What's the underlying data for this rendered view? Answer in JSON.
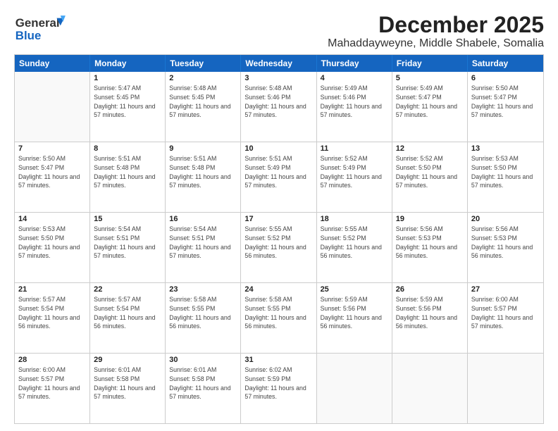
{
  "logo": {
    "line1": "General",
    "line2": "Blue"
  },
  "title": "December 2025",
  "subtitle": "Mahaddayweyne, Middle Shabele, Somalia",
  "header_days": [
    "Sunday",
    "Monday",
    "Tuesday",
    "Wednesday",
    "Thursday",
    "Friday",
    "Saturday"
  ],
  "rows": [
    [
      {
        "day": "",
        "sunrise": "",
        "sunset": "",
        "daylight": ""
      },
      {
        "day": "1",
        "sunrise": "Sunrise: 5:47 AM",
        "sunset": "Sunset: 5:45 PM",
        "daylight": "Daylight: 11 hours and 57 minutes."
      },
      {
        "day": "2",
        "sunrise": "Sunrise: 5:48 AM",
        "sunset": "Sunset: 5:45 PM",
        "daylight": "Daylight: 11 hours and 57 minutes."
      },
      {
        "day": "3",
        "sunrise": "Sunrise: 5:48 AM",
        "sunset": "Sunset: 5:46 PM",
        "daylight": "Daylight: 11 hours and 57 minutes."
      },
      {
        "day": "4",
        "sunrise": "Sunrise: 5:49 AM",
        "sunset": "Sunset: 5:46 PM",
        "daylight": "Daylight: 11 hours and 57 minutes."
      },
      {
        "day": "5",
        "sunrise": "Sunrise: 5:49 AM",
        "sunset": "Sunset: 5:47 PM",
        "daylight": "Daylight: 11 hours and 57 minutes."
      },
      {
        "day": "6",
        "sunrise": "Sunrise: 5:50 AM",
        "sunset": "Sunset: 5:47 PM",
        "daylight": "Daylight: 11 hours and 57 minutes."
      }
    ],
    [
      {
        "day": "7",
        "sunrise": "Sunrise: 5:50 AM",
        "sunset": "Sunset: 5:47 PM",
        "daylight": "Daylight: 11 hours and 57 minutes."
      },
      {
        "day": "8",
        "sunrise": "Sunrise: 5:51 AM",
        "sunset": "Sunset: 5:48 PM",
        "daylight": "Daylight: 11 hours and 57 minutes."
      },
      {
        "day": "9",
        "sunrise": "Sunrise: 5:51 AM",
        "sunset": "Sunset: 5:48 PM",
        "daylight": "Daylight: 11 hours and 57 minutes."
      },
      {
        "day": "10",
        "sunrise": "Sunrise: 5:51 AM",
        "sunset": "Sunset: 5:49 PM",
        "daylight": "Daylight: 11 hours and 57 minutes."
      },
      {
        "day": "11",
        "sunrise": "Sunrise: 5:52 AM",
        "sunset": "Sunset: 5:49 PM",
        "daylight": "Daylight: 11 hours and 57 minutes."
      },
      {
        "day": "12",
        "sunrise": "Sunrise: 5:52 AM",
        "sunset": "Sunset: 5:50 PM",
        "daylight": "Daylight: 11 hours and 57 minutes."
      },
      {
        "day": "13",
        "sunrise": "Sunrise: 5:53 AM",
        "sunset": "Sunset: 5:50 PM",
        "daylight": "Daylight: 11 hours and 57 minutes."
      }
    ],
    [
      {
        "day": "14",
        "sunrise": "Sunrise: 5:53 AM",
        "sunset": "Sunset: 5:50 PM",
        "daylight": "Daylight: 11 hours and 57 minutes."
      },
      {
        "day": "15",
        "sunrise": "Sunrise: 5:54 AM",
        "sunset": "Sunset: 5:51 PM",
        "daylight": "Daylight: 11 hours and 57 minutes."
      },
      {
        "day": "16",
        "sunrise": "Sunrise: 5:54 AM",
        "sunset": "Sunset: 5:51 PM",
        "daylight": "Daylight: 11 hours and 57 minutes."
      },
      {
        "day": "17",
        "sunrise": "Sunrise: 5:55 AM",
        "sunset": "Sunset: 5:52 PM",
        "daylight": "Daylight: 11 hours and 56 minutes."
      },
      {
        "day": "18",
        "sunrise": "Sunrise: 5:55 AM",
        "sunset": "Sunset: 5:52 PM",
        "daylight": "Daylight: 11 hours and 56 minutes."
      },
      {
        "day": "19",
        "sunrise": "Sunrise: 5:56 AM",
        "sunset": "Sunset: 5:53 PM",
        "daylight": "Daylight: 11 hours and 56 minutes."
      },
      {
        "day": "20",
        "sunrise": "Sunrise: 5:56 AM",
        "sunset": "Sunset: 5:53 PM",
        "daylight": "Daylight: 11 hours and 56 minutes."
      }
    ],
    [
      {
        "day": "21",
        "sunrise": "Sunrise: 5:57 AM",
        "sunset": "Sunset: 5:54 PM",
        "daylight": "Daylight: 11 hours and 56 minutes."
      },
      {
        "day": "22",
        "sunrise": "Sunrise: 5:57 AM",
        "sunset": "Sunset: 5:54 PM",
        "daylight": "Daylight: 11 hours and 56 minutes."
      },
      {
        "day": "23",
        "sunrise": "Sunrise: 5:58 AM",
        "sunset": "Sunset: 5:55 PM",
        "daylight": "Daylight: 11 hours and 56 minutes."
      },
      {
        "day": "24",
        "sunrise": "Sunrise: 5:58 AM",
        "sunset": "Sunset: 5:55 PM",
        "daylight": "Daylight: 11 hours and 56 minutes."
      },
      {
        "day": "25",
        "sunrise": "Sunrise: 5:59 AM",
        "sunset": "Sunset: 5:56 PM",
        "daylight": "Daylight: 11 hours and 56 minutes."
      },
      {
        "day": "26",
        "sunrise": "Sunrise: 5:59 AM",
        "sunset": "Sunset: 5:56 PM",
        "daylight": "Daylight: 11 hours and 56 minutes."
      },
      {
        "day": "27",
        "sunrise": "Sunrise: 6:00 AM",
        "sunset": "Sunset: 5:57 PM",
        "daylight": "Daylight: 11 hours and 57 minutes."
      }
    ],
    [
      {
        "day": "28",
        "sunrise": "Sunrise: 6:00 AM",
        "sunset": "Sunset: 5:57 PM",
        "daylight": "Daylight: 11 hours and 57 minutes."
      },
      {
        "day": "29",
        "sunrise": "Sunrise: 6:01 AM",
        "sunset": "Sunset: 5:58 PM",
        "daylight": "Daylight: 11 hours and 57 minutes."
      },
      {
        "day": "30",
        "sunrise": "Sunrise: 6:01 AM",
        "sunset": "Sunset: 5:58 PM",
        "daylight": "Daylight: 11 hours and 57 minutes."
      },
      {
        "day": "31",
        "sunrise": "Sunrise: 6:02 AM",
        "sunset": "Sunset: 5:59 PM",
        "daylight": "Daylight: 11 hours and 57 minutes."
      },
      {
        "day": "",
        "sunrise": "",
        "sunset": "",
        "daylight": ""
      },
      {
        "day": "",
        "sunrise": "",
        "sunset": "",
        "daylight": ""
      },
      {
        "day": "",
        "sunrise": "",
        "sunset": "",
        "daylight": ""
      }
    ]
  ]
}
